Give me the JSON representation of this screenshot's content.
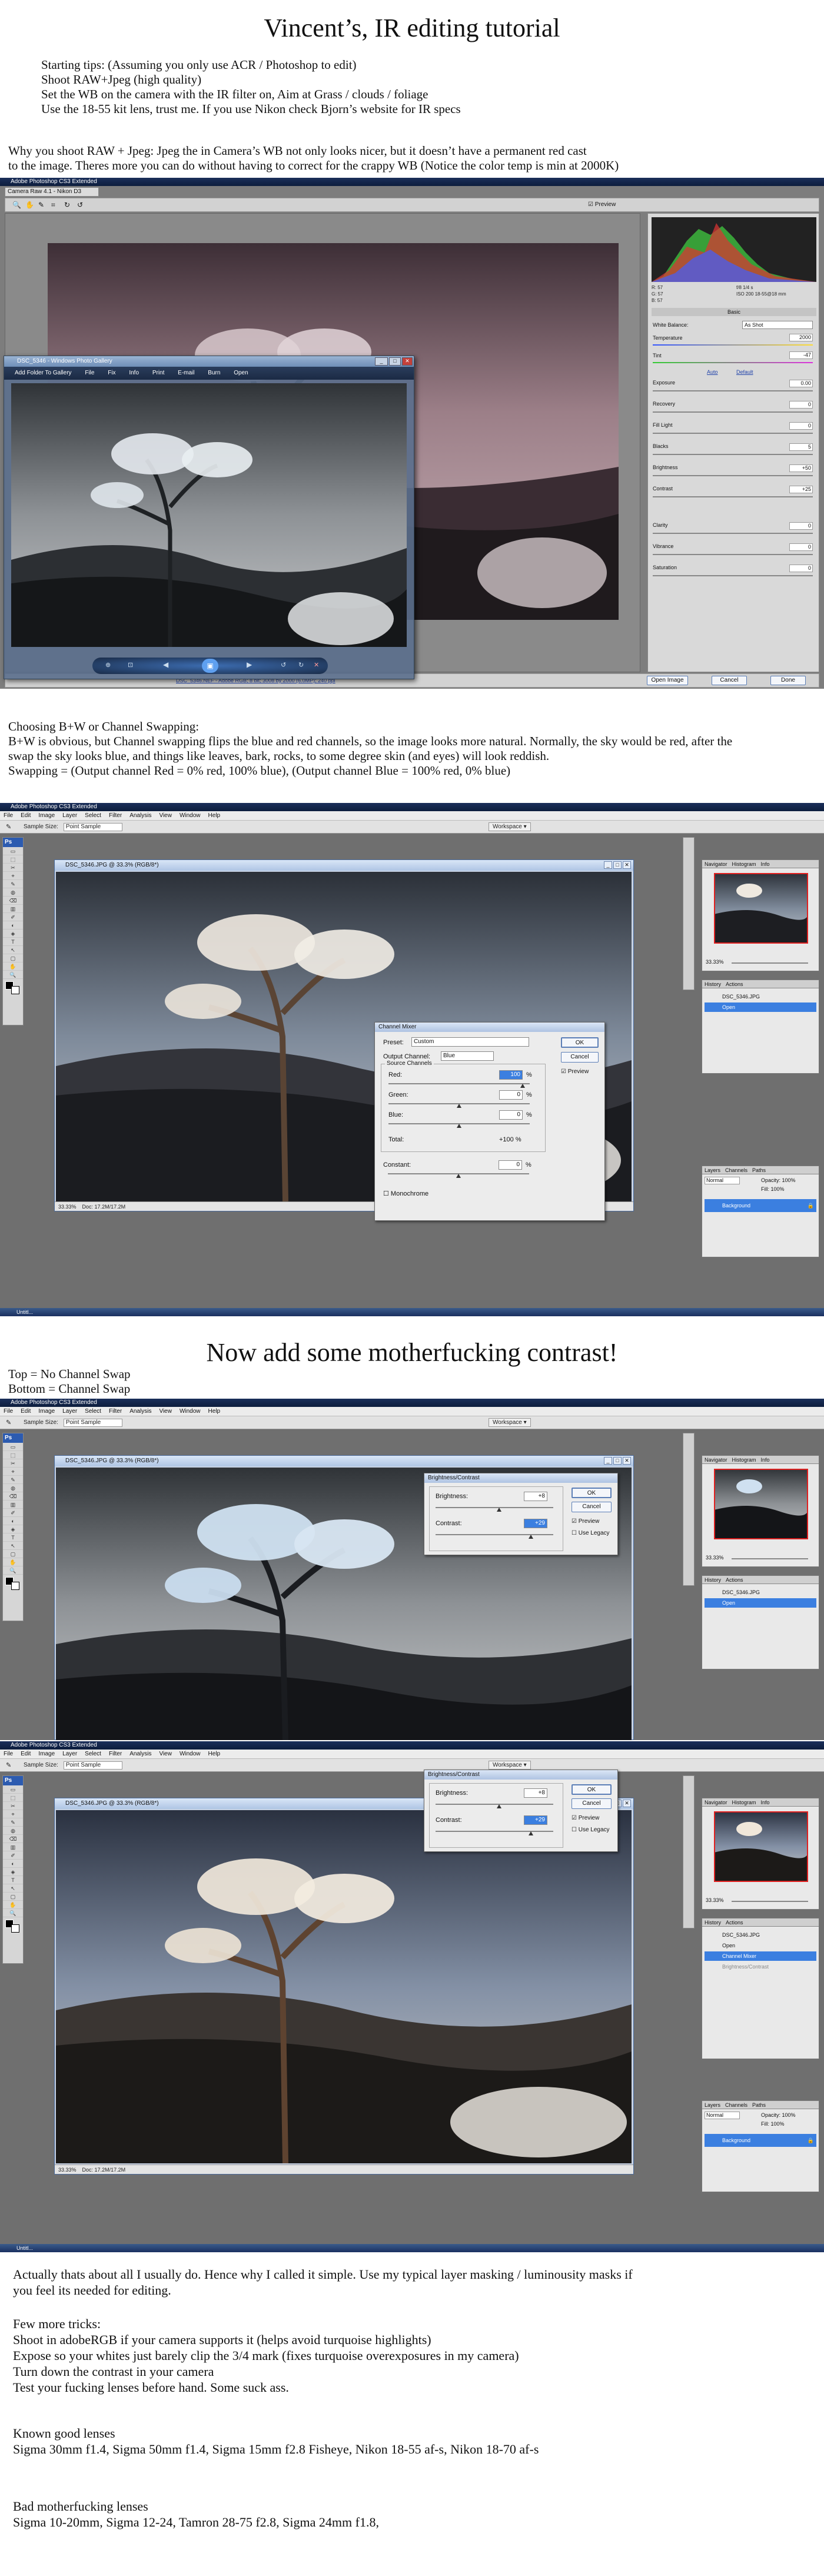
{
  "title": "Vincent’s, IR editing tutorial",
  "tips": [
    "Starting tips: (Assuming you only use ACR / Photoshop to edit)",
    "Shoot RAW+Jpeg (high quality)",
    "Set the WB on the camera with the IR filter on, Aim at Grass / clouds / foliage",
    "Use the 18-55 kit lens, trust me. If you use Nikon check Bjorn’s website for IR specs"
  ],
  "raw_para": [
    "Why you shoot RAW + Jpeg: Jpeg the in Camera’s WB not only looks nicer, but it doesn’t have a permanent red cast",
    "to the image. Theres more you can do without having to correct for the crappy WB (Notice the color temp is min at 2000K)"
  ],
  "acr": {
    "app_title": "Adobe Photoshop CS3 Extended",
    "window_title": "Camera Raw 4.1 - Nikon D3",
    "preview_label": "Preview",
    "status_text": "DSC_5346.NEF - Adobe RGB; 8 bit; 3008 by 2000 (6.0MP); 240 ppi",
    "readout": [
      "R: 57",
      "G: 57",
      "B: 57",
      "f/8  1/4 s",
      "ISO 200  18-55@18 mm"
    ],
    "panel_tabs": "Basic",
    "wb_label": "White Balance:",
    "wb_value": "As Shot",
    "temp_label": "Temperature",
    "temp_value": "2000",
    "tint_label": "Tint",
    "tint_value": "-47",
    "auto_label": "Auto",
    "default_label": "Default",
    "sliders": [
      {
        "label": "Exposure",
        "value": "0.00"
      },
      {
        "label": "Recovery",
        "value": "0"
      },
      {
        "label": "Fill Light",
        "value": "0"
      },
      {
        "label": "Blacks",
        "value": "5"
      },
      {
        "label": "Brightness",
        "value": "+50"
      },
      {
        "label": "Contrast",
        "value": "+25"
      },
      {
        "label": "Clarity",
        "value": "0"
      },
      {
        "label": "Vibrance",
        "value": "0"
      },
      {
        "label": "Saturation",
        "value": "0"
      }
    ],
    "open_btn": "Open Image",
    "cancel_btn": "Cancel",
    "done_btn": "Done",
    "viewer_title": "DSC_5346 - Windows Photo Gallery",
    "viewer_menu": [
      "Add Folder To Gallery",
      "File",
      "Fix",
      "Info",
      "Print",
      "E-mail",
      "Burn",
      "Open"
    ]
  },
  "bw_para": [
    "Choosing B+W or Channel Swapping:",
    "B+W is obvious, but Channel swapping flips the blue and red channels, so the image looks more natural. Normally, the sky would be red, after the",
    "swap the sky looks blue, and things like leaves, bark, rocks, to some degree skin (and eyes) will look reddish.",
    "Swapping = (Output channel Red = 0% red, 100% blue), (Output channel Blue = 100% red, 0% blue)"
  ],
  "ps": {
    "app_title": "Adobe Photoshop CS3 Extended",
    "menu": [
      "File",
      "Edit",
      "Image",
      "Layer",
      "Select",
      "Filter",
      "Analysis",
      "View",
      "Window",
      "Help"
    ],
    "sample_size_label": "Sample Size:",
    "sample_size_value": "Point Sample",
    "workspace_label": "Workspace",
    "doc_title": "DSC_5346.JPG @ 33.3% (RGB/8*)",
    "zoom": "33.33%",
    "doc_size": "Doc: 17.2M/17.2M",
    "nav_tabs": [
      "Navigator",
      "Histogram",
      "Info"
    ],
    "nav_zoom": "33.33%",
    "history_tabs": [
      "History",
      "Actions"
    ],
    "history_file": "DSC_5346.JPG",
    "history_open": "Open",
    "history_channel_mixer": "Channel Mixer",
    "history_bc": "Brightness/Contrast",
    "layers_tabs": [
      "Layers",
      "Channels",
      "Paths"
    ],
    "blend_mode": "Normal",
    "opacity": "Opacity: 100%",
    "fill": "Fill: 100%",
    "layer_name": "Background",
    "taskbar_text": "Untitl..."
  },
  "channel_mixer": {
    "title": "Channel Mixer",
    "preset_label": "Preset:",
    "preset_value": "Custom",
    "output_label": "Output Channel:",
    "output_value": "Blue",
    "source_label": "Source Channels",
    "red_label": "Red:",
    "red_value": "100",
    "green_label": "Green:",
    "green_value": "0",
    "blue_label": "Blue:",
    "blue_value": "0",
    "pct": "%",
    "total_label": "Total:",
    "total_value": "+100 %",
    "constant_label": "Constant:",
    "constant_value": "0",
    "monochrome_label": "Monochrome",
    "ok": "OK",
    "cancel": "Cancel",
    "preview": "Preview"
  },
  "contrast_heading": "Now add some motherfucking contrast!",
  "compare_lines": [
    "Top = No Channel Swap",
    "Bottom = Channel Swap"
  ],
  "brightness_contrast": {
    "title": "Brightness/Contrast",
    "brightness_label": "Brightness:",
    "brightness_value": "+8",
    "contrast_label": "Contrast:",
    "contrast_value": "+29",
    "ok": "OK",
    "cancel": "Cancel",
    "preview": "Preview",
    "legacy": "Use Legacy"
  },
  "closing": [
    "Actually thats about all I usually do. Hence why I called it simple. Use my typical layer masking / luminousity masks if",
    "you feel its needed for editing."
  ],
  "tricks": [
    "Few more tricks:",
    "Shoot in adobeRGB if your camera supports it (helps avoid turquoise highlights)",
    "Expose so your whites just barely clip the 3/4 mark (fixes turquoise overexposures in my camera)",
    "Turn down the contrast in your camera",
    "Test your fucking lenses before hand. Some suck ass."
  ],
  "good_lenses": [
    "Known good lenses",
    "Sigma 30mm f1.4, Sigma 50mm f1.4, Sigma 15mm f2.8 Fisheye, Nikon 18-55 af-s, Nikon 18-70 af-s"
  ],
  "bad_lenses": [
    "Bad motherfucking lenses",
    "Sigma 10-20mm, Sigma 12-24, Tamron 28-75 f2.8, Sigma 24mm f1.8,"
  ]
}
